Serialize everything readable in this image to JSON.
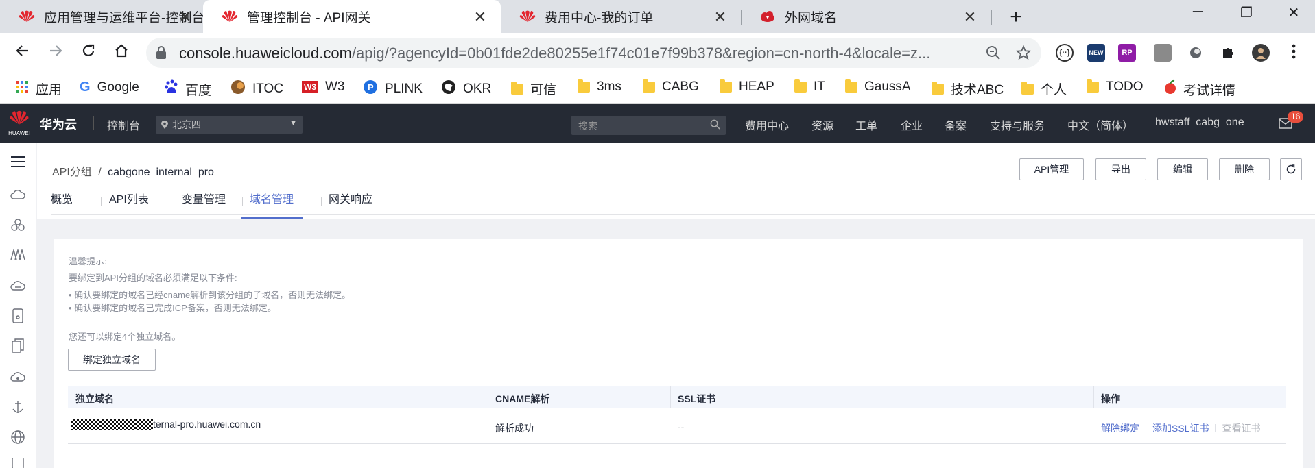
{
  "browser": {
    "tabs": [
      {
        "title": "应用管理与运维平台-控制台",
        "icon": "huawei-logo-icon",
        "active": false
      },
      {
        "title": "管理控制台 - API网关",
        "icon": "huawei-logo-icon",
        "active": true
      },
      {
        "title": "费用中心-我的订单",
        "icon": "huawei-logo-icon",
        "active": false
      },
      {
        "title": "外网域名",
        "icon": "weather-cloud-icon",
        "active": false
      }
    ],
    "tab_close": "✕",
    "new_tab": "+",
    "window_controls": {
      "minimize": "─",
      "restore": "❐",
      "close": "✕"
    },
    "url_host": "console.huaweicloud.com",
    "url_rest": "/apig/?agencyId=0b01fde2de80255e1f74c01e7f99b378&region=cn-north-4&locale=z...",
    "extensions": [
      {
        "name": "code-extension-icon",
        "label": "{··}"
      },
      {
        "name": "new-extension-icon",
        "label": "NEW"
      },
      {
        "name": "rp-extension-icon",
        "label": "RP"
      },
      {
        "name": "pdf-extension-icon",
        "label": ""
      },
      {
        "name": "circle-extension-icon",
        "label": ""
      },
      {
        "name": "puzzle-extension-icon",
        "label": ""
      },
      {
        "name": "profile-avatar-icon",
        "label": ""
      }
    ],
    "bookmarks": [
      {
        "label": "应用",
        "icon": "apps-grid-icon"
      },
      {
        "label": "Google",
        "icon": "google-icon"
      },
      {
        "label": "百度",
        "icon": "baidu-icon"
      },
      {
        "label": "ITOC",
        "icon": "itoc-icon"
      },
      {
        "label": "W3",
        "icon": "w3-icon"
      },
      {
        "label": "PLINK",
        "icon": "plink-icon"
      },
      {
        "label": "OKR",
        "icon": "okr-icon"
      },
      {
        "label": "可信",
        "icon": "folder-icon"
      },
      {
        "label": "3ms",
        "icon": "folder-icon"
      },
      {
        "label": "CABG",
        "icon": "folder-icon"
      },
      {
        "label": "HEAP",
        "icon": "folder-icon"
      },
      {
        "label": "IT",
        "icon": "folder-icon"
      },
      {
        "label": "GaussA",
        "icon": "folder-icon"
      },
      {
        "label": "技术ABC",
        "icon": "folder-icon"
      },
      {
        "label": "个人",
        "icon": "folder-icon"
      },
      {
        "label": "TODO",
        "icon": "folder-icon"
      },
      {
        "label": "考试详情",
        "icon": "exam-icon"
      }
    ]
  },
  "console": {
    "logo_text": "HUAWEI",
    "brand": "华为云",
    "console_link": "控制台",
    "region": "北京四",
    "search_placeholder": "搜索",
    "nav": [
      "费用中心",
      "资源",
      "工单",
      "企业",
      "备案",
      "支持与服务",
      "中文（简体）",
      "hwstaff_cabg_one"
    ],
    "mail_badge": "16"
  },
  "page": {
    "breadcrumb_parent": "API分组",
    "breadcrumb_sep": "/",
    "breadcrumb_current": "cabgone_internal_pro",
    "actions": [
      "API管理",
      "导出",
      "编辑",
      "删除"
    ],
    "tabs": [
      "概览",
      "API列表",
      "变量管理",
      "域名管理",
      "网关响应"
    ],
    "active_tab": "域名管理"
  },
  "tips": {
    "title": "温馨提示:",
    "line1": "要绑定到API分组的域名必须满足以下条件:",
    "line2": "• 确认要绑定的域名已经cname解析到该分组的子域名，否则无法绑定。",
    "line3": "• 确认要绑定的域名已完成ICP备案，否则无法绑定。",
    "remaining": "您还可以绑定4个独立域名。"
  },
  "bind_button": "绑定独立域名",
  "table": {
    "headers": [
      "独立域名",
      "CNAME解析",
      "SSL证书",
      "操作"
    ],
    "rows": [
      {
        "domain_suffix": "ternal-pro.huawei.com.cn",
        "cname": "解析成功",
        "ssl": "--",
        "ops": [
          "解除绑定",
          "添加SSL证书",
          "查看证书"
        ]
      }
    ]
  },
  "colors": {
    "accent": "#526ecc",
    "header_bg": "#252a34",
    "table_head_bg": "#f3f6fc"
  }
}
